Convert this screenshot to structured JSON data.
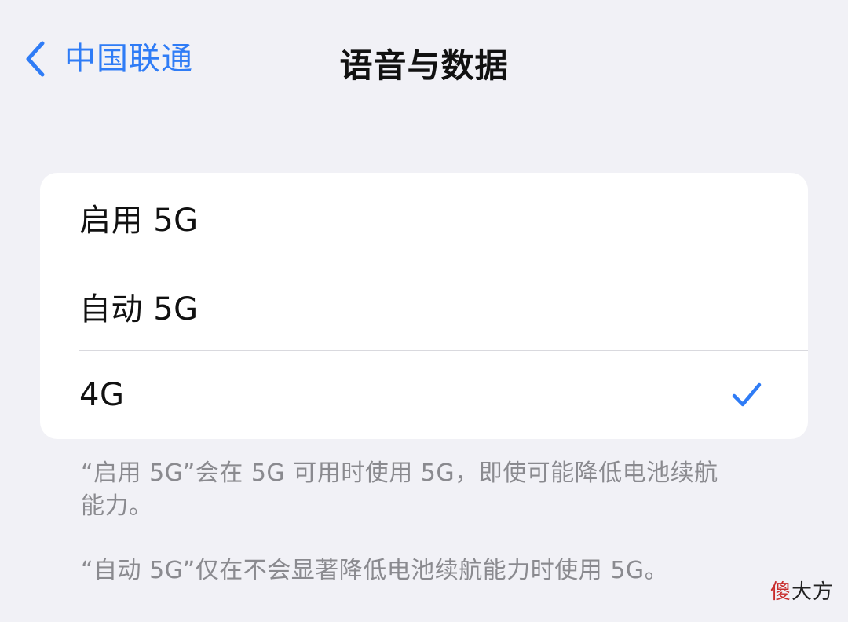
{
  "nav": {
    "back_label": "中国联通",
    "title": "语音与数据"
  },
  "options": [
    {
      "label": "启用 5G",
      "selected": false
    },
    {
      "label": "自动 5G",
      "selected": false
    },
    {
      "label": "4G",
      "selected": true
    }
  ],
  "notes": [
    "“启用 5G”会在 5G 可用时使用 5G，即使可能降低电池续航能力。",
    "“自动 5G”仅在不会显著降低电池续航能力时使用 5G。"
  ],
  "watermark": {
    "accent": "傻",
    "rest": "大方"
  },
  "colors": {
    "accent": "#2f7cf6",
    "background": "#f1f1f6",
    "card": "#ffffff",
    "note_text": "#8a8a8f"
  },
  "icons": {
    "back": "chevron-left-icon",
    "selected": "checkmark-icon"
  }
}
